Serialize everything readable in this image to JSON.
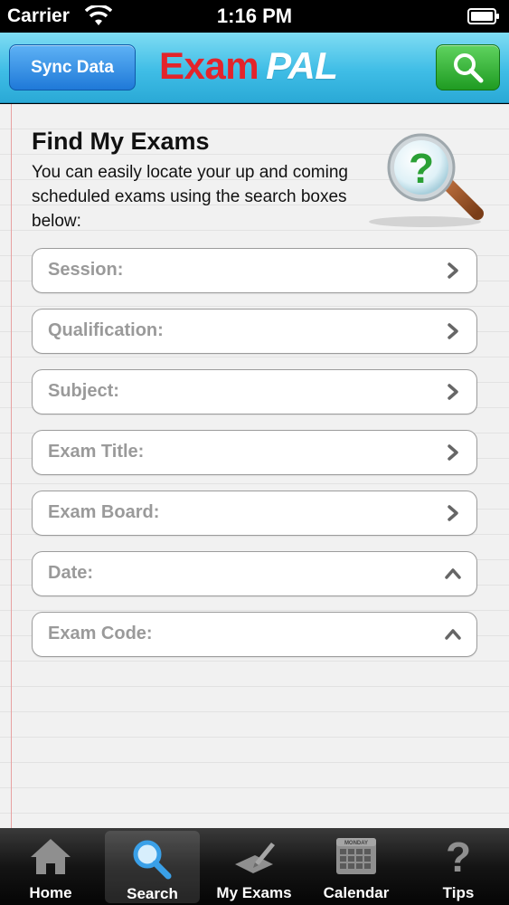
{
  "status": {
    "carrier": "Carrier",
    "time": "1:16 PM"
  },
  "header": {
    "sync_label": "Sync Data",
    "logo_exam": "Exam",
    "logo_pal": "PAL",
    "search_icon": "search-icon"
  },
  "main": {
    "title": "Find My Exams",
    "description": "You can easily locate your up and coming scheduled exams using the search boxes below:",
    "fields": [
      {
        "label": "Session:",
        "chevron": "chevron-right"
      },
      {
        "label": "Qualification:",
        "chevron": "chevron-right"
      },
      {
        "label": "Subject:",
        "chevron": "chevron-right"
      },
      {
        "label": "Exam Title:",
        "chevron": "chevron-right"
      },
      {
        "label": "Exam Board:",
        "chevron": "chevron-right"
      },
      {
        "label": "Date:",
        "chevron": "chevron-up"
      },
      {
        "label": "Exam Code:",
        "chevron": "chevron-up"
      }
    ]
  },
  "tabs": [
    {
      "label": "Home",
      "icon": "home-icon"
    },
    {
      "label": "Search",
      "icon": "search-icon",
      "selected": true
    },
    {
      "label": "My Exams",
      "icon": "exam-paper-icon"
    },
    {
      "label": "Calendar",
      "icon": "calendar-icon",
      "icon_text": "MONDAY"
    },
    {
      "label": "Tips",
      "icon": "question-icon"
    }
  ],
  "colors": {
    "header": "#3fbde6",
    "sync_button": "#1f79d8",
    "search_button": "#1f9b22",
    "logo_red": "#e3242b",
    "question_green": "#2aa035"
  }
}
